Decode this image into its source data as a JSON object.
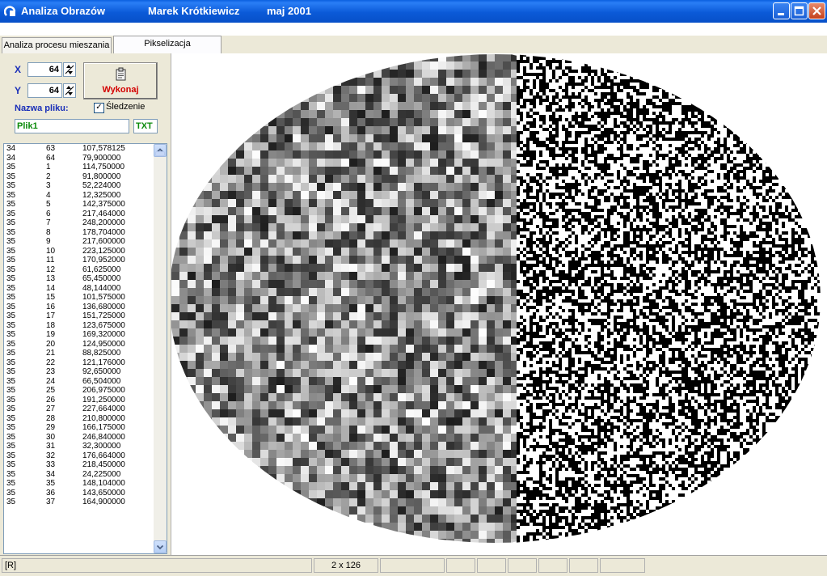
{
  "window": {
    "app_title": "Analiza Obrazów",
    "author": "Marek Krótkiewicz",
    "date": "maj 2001"
  },
  "tabs": [
    {
      "label": "Analiza procesu mieszania",
      "active": false
    },
    {
      "label": "Pikselizacja",
      "active": true
    }
  ],
  "controls": {
    "x_label": "X",
    "x_value": "64",
    "y_label": "Y",
    "y_value": "64",
    "run_label": "Wykonaj",
    "filename_label": "Nazwa pliku:",
    "tracking_label": "Śledzenie",
    "tracking_checked": true,
    "check_mark": "✓",
    "filename_value": "Plik1",
    "extension_value": "TXT"
  },
  "list_rows": [
    [
      "34",
      "63",
      "107,578125"
    ],
    [
      "34",
      "64",
      "79,900000"
    ],
    [
      "35",
      "1",
      "114,750000"
    ],
    [
      "35",
      "2",
      "91,800000"
    ],
    [
      "35",
      "3",
      "52,224000"
    ],
    [
      "35",
      "4",
      "12,325000"
    ],
    [
      "35",
      "5",
      "142,375000"
    ],
    [
      "35",
      "6",
      "217,464000"
    ],
    [
      "35",
      "7",
      "248,200000"
    ],
    [
      "35",
      "8",
      "178,704000"
    ],
    [
      "35",
      "9",
      "217,600000"
    ],
    [
      "35",
      "10",
      "223,125000"
    ],
    [
      "35",
      "11",
      "170,952000"
    ],
    [
      "35",
      "12",
      "61,625000"
    ],
    [
      "35",
      "13",
      "65,450000"
    ],
    [
      "35",
      "14",
      "48,144000"
    ],
    [
      "35",
      "15",
      "101,575000"
    ],
    [
      "35",
      "16",
      "136,680000"
    ],
    [
      "35",
      "17",
      "151,725000"
    ],
    [
      "35",
      "18",
      "123,675000"
    ],
    [
      "35",
      "19",
      "169,320000"
    ],
    [
      "35",
      "20",
      "124,950000"
    ],
    [
      "35",
      "21",
      "88,825000"
    ],
    [
      "35",
      "22",
      "121,176000"
    ],
    [
      "35",
      "23",
      "92,650000"
    ],
    [
      "35",
      "24",
      "66,504000"
    ],
    [
      "35",
      "25",
      "206,975000"
    ],
    [
      "35",
      "26",
      "191,250000"
    ],
    [
      "35",
      "27",
      "227,664000"
    ],
    [
      "35",
      "28",
      "210,800000"
    ],
    [
      "35",
      "29",
      "166,175000"
    ],
    [
      "35",
      "30",
      "246,840000"
    ],
    [
      "35",
      "31",
      "32,300000"
    ],
    [
      "35",
      "32",
      "176,664000"
    ],
    [
      "35",
      "33",
      "218,450000"
    ],
    [
      "35",
      "34",
      "24,225000"
    ],
    [
      "35",
      "35",
      "148,104000"
    ],
    [
      "35",
      "36",
      "143,650000"
    ],
    [
      "35",
      "37",
      "164,900000"
    ]
  ],
  "status": {
    "mode": "[R]",
    "size": "2 x 126"
  },
  "colors": {
    "title_bar": "#0b5ad8",
    "label_blue": "#1a2fb8",
    "run_red": "#d40000",
    "filename_green": "#0a8a0a",
    "panel": "#ece9d8"
  },
  "icons": [
    "app-icon",
    "minimize-icon",
    "maximize-icon",
    "close-icon",
    "spin-arrows-icon",
    "execute-icon",
    "scroll-up-icon",
    "scroll-down-icon"
  ]
}
